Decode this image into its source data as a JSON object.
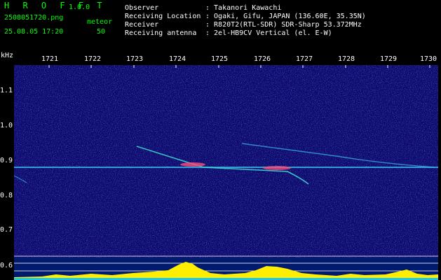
{
  "header": {
    "app_name": "H R O F F T",
    "version": "1.0.0",
    "filename": "2508051720.png",
    "datetime": "25.08.05 17:20",
    "meteor_label": "meteor",
    "meteor_count": "50",
    "fields": [
      {
        "label": "Observer",
        "value": ": Takanori Kawachi"
      },
      {
        "label": "Receiving Location",
        "value": ": Ogaki, Gifu, JAPAN (136.60E, 35.35N)"
      },
      {
        "label": "Receiver",
        "value": ": R820T2(RTL-SDR) SDR-Sharp 53.372MHz"
      },
      {
        "label": "Receiving antenna",
        "value": ": 2el-HB9CV Vertical (el. E-W)"
      }
    ]
  },
  "axes": {
    "unit_label": "kHz",
    "freq_ticks": [
      "1.1",
      "1.0",
      "0.9",
      "0.8",
      "0.7",
      "0.6"
    ],
    "time_ticks": [
      "1721",
      "1722",
      "1723",
      "1724",
      "1725",
      "1726",
      "1727",
      "1728",
      "1729",
      "1730"
    ]
  },
  "colors": {
    "header_text": "#00ff00",
    "label_text": "#ffffff",
    "background": "#0c0a6b",
    "signal_line": "#39b6e6",
    "meteor_echo": "#ff4d7a",
    "activity_bar": "#ffee00"
  }
}
